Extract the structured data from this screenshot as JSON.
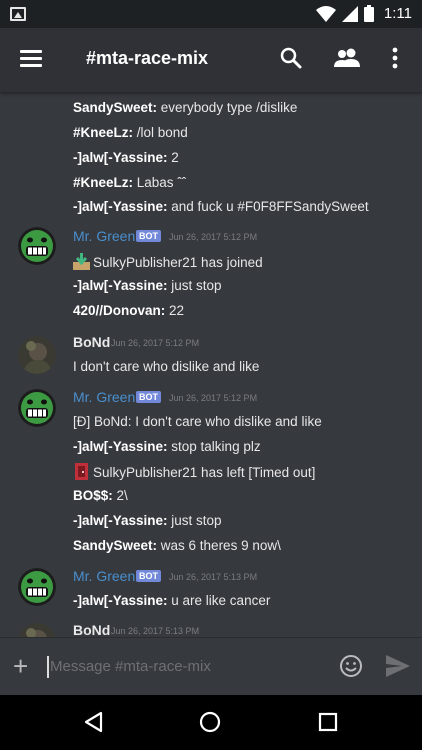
{
  "status": {
    "time": "1:11"
  },
  "appbar": {
    "title": "#mta-race-mix"
  },
  "messages": {
    "g1": [
      {
        "author": "SandySweet:",
        "text": " everybody type /dislike"
      },
      {
        "author": "#KneeLz:",
        "text": "  /lol bond"
      },
      {
        "author": "-]alw[-Yassine:",
        "text": " 2"
      },
      {
        "author": "#KneeLz:",
        "text": " Labas ˆˆ"
      },
      {
        "author": "-]alw[-Yassine:",
        "text": " and fuck u #F0F8FFSandySweet"
      }
    ],
    "g2": {
      "author": "Mr. Green",
      "bot": "BOT",
      "timestamp": "Jun 26, 2017 5:12 PM",
      "lines": [
        {
          "author": "",
          "text": "SulkyPublisher21 has joined"
        },
        {
          "author": "-]alw[-Yassine:",
          "text": " just stop"
        },
        {
          "author": "420//Donovan:",
          "text": " 22"
        }
      ]
    },
    "g3": {
      "author": "BoNd",
      "timestamp": "Jun 26, 2017 5:12 PM",
      "lines": [
        {
          "text": "I don't care who dislike and like"
        }
      ]
    },
    "g4": {
      "author": "Mr. Green",
      "bot": "BOT",
      "timestamp": "Jun 26, 2017 5:12 PM",
      "lines": [
        {
          "author": "",
          "text": "[Ð] BoNd: I don't care who dislike and like"
        },
        {
          "author": "-]alw[-Yassine:",
          "text": " stop talking plz"
        },
        {
          "author": "",
          "text": "SulkyPublisher21 has left [Timed out]"
        },
        {
          "author": "BO$$:",
          "text": " 2\\"
        },
        {
          "author": "-]alw[-Yassine:",
          "text": " just stop"
        },
        {
          "author": "SandySweet:",
          "text": " was 6 theres 9 now\\"
        }
      ]
    },
    "g5": {
      "author": "Mr. Green",
      "bot": "BOT",
      "timestamp": "Jun 26, 2017 5:13 PM",
      "lines": [
        {
          "author": "-]alw[-Yassine:",
          "text": " u are like cancer"
        }
      ]
    },
    "g6": {
      "author": "BoNd",
      "timestamp": "Jun 26, 2017 5:13 PM"
    }
  },
  "input": {
    "placeholder": "Message #mta-race-mix"
  }
}
